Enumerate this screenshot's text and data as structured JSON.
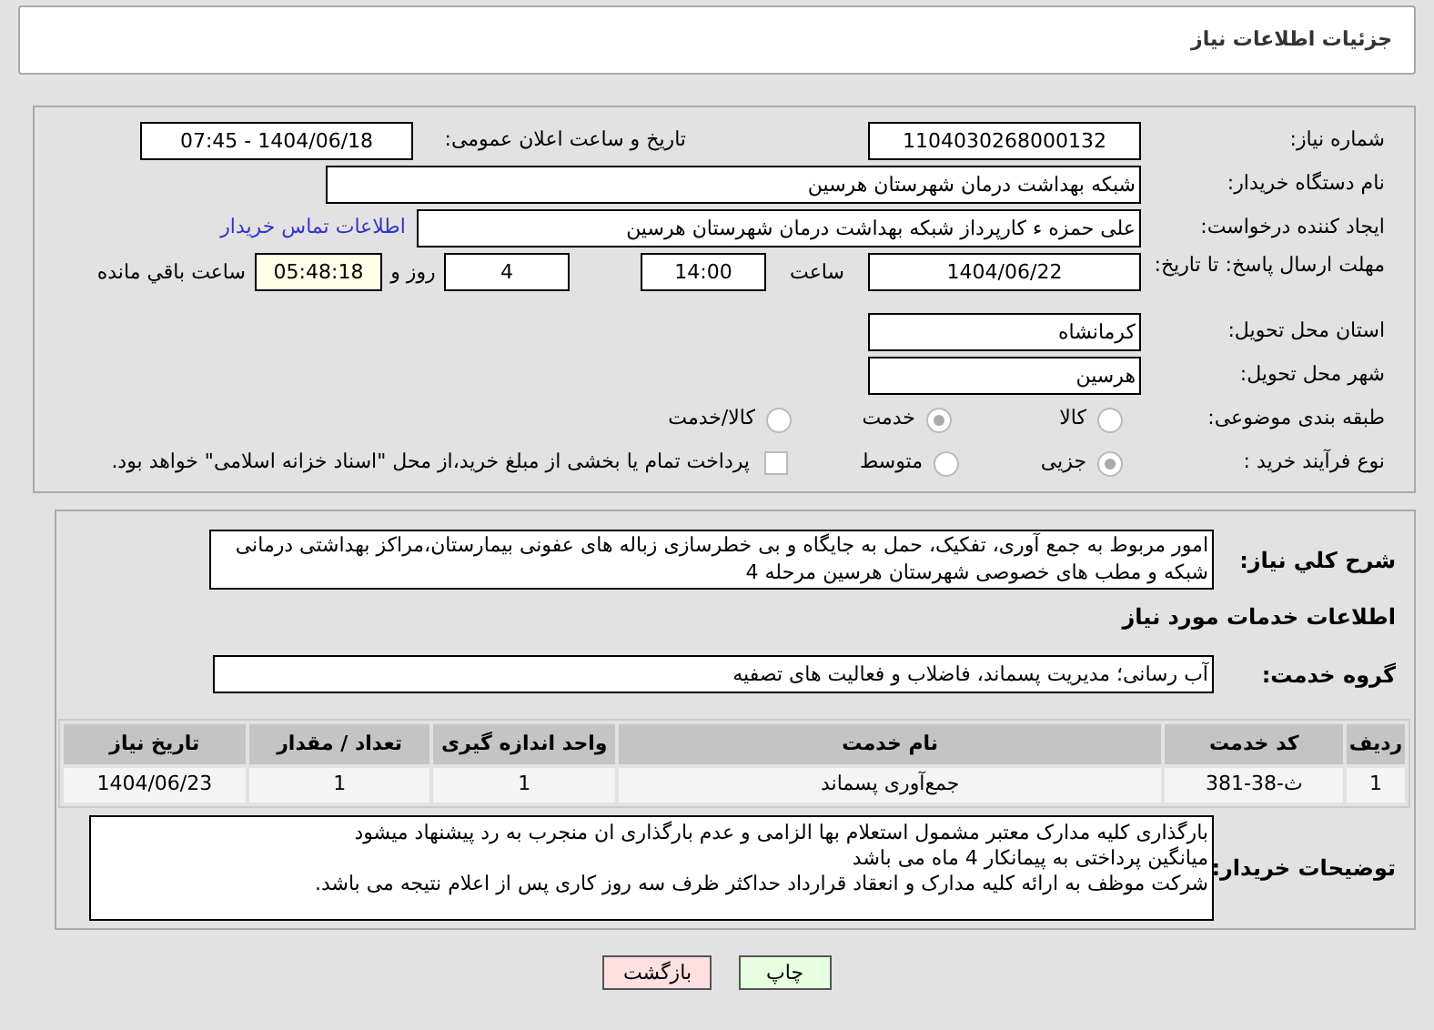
{
  "header": {
    "title": "جزئیات اطلاعات نیاز"
  },
  "need_number": {
    "label": "شماره نیاز:",
    "value": "1104030268000132"
  },
  "announce": {
    "label": "تاریخ و ساعت اعلان عمومی:",
    "value": "1404/06/18 - 07:45"
  },
  "buyer": {
    "label": "نام دستگاه خریدار:",
    "value": "شبکه بهداشت درمان شهرستان هرسین"
  },
  "creator": {
    "label": "ایجاد کننده درخواست:",
    "value": "علی حمزه ء کارپرداز شبکه بهداشت درمان شهرستان هرسین",
    "link": "اطلاعات تماس خریدار"
  },
  "deadline": {
    "label": "مهلت ارسال پاسخ: تا تاریخ:",
    "date": "1404/06/22",
    "time_label": "ساعت",
    "time": "14:00",
    "days": "4",
    "days_label": "روز و",
    "remaining": "05:48:18",
    "remaining_label": "ساعت باقي مانده"
  },
  "province": {
    "label": "استان محل تحویل:",
    "value": "کرمانشاه"
  },
  "city": {
    "label": "شهر محل تحویل:",
    "value": "هرسین"
  },
  "category": {
    "label": "طبقه بندی موضوعی:",
    "options": [
      {
        "label": "کالا",
        "selected": false
      },
      {
        "label": "خدمت",
        "selected": true
      },
      {
        "label": "کالا/خدمت",
        "selected": false
      }
    ]
  },
  "process": {
    "label": "نوع فرآیند خرید :",
    "options": [
      {
        "label": "جزیی",
        "selected": true
      },
      {
        "label": "متوسط",
        "selected": false
      }
    ],
    "treasury": {
      "checked": false,
      "label": "پرداخت تمام یا بخشی از مبلغ خرید،از محل \"اسناد خزانه اسلامی\" خواهد بود."
    }
  },
  "description": {
    "label": "شرح کلي نياز:",
    "value": "امور مربوط به جمع آوری، تفکیک، حمل به جایگاه و بی خطرسازی زباله های عفونی بیمارستان،مراکز بهداشتی درمانی شبکه و مطب های خصوصی شهرستان هرسین مرحله 4"
  },
  "services_title": "اطلاعات خدمات مورد نیاز",
  "service_group": {
    "label": "گروه خدمت:",
    "value": "آب رسانی؛ مدیریت پسماند، فاضلاب و فعالیت های تصفیه"
  },
  "table": {
    "columns": [
      "ردیف",
      "کد خدمت",
      "نام خدمت",
      "واحد اندازه گیری",
      "تعداد / مقدار",
      "تاریخ نیاز"
    ],
    "rows": [
      [
        "1",
        "ث-38-381",
        "جمع‌آوری پسماند",
        "1",
        "1",
        "1404/06/23"
      ]
    ]
  },
  "notes": {
    "label": "توضیحات خریدار:",
    "lines": [
      "بارگذاری کلیه مدارک معتبر مشمول استعلام بها الزامی و عدم بارگذاری ان منجرب به رد پیشنهاد میشود",
      "میانگین پرداختی به پیمانکار 4 ماه می باشد",
      "شرکت موظف به ارائه کلیه مدارک و انعقاد قرارداد حداکثر ظرف سه روز کاری پس از اعلام نتیجه می باشد."
    ]
  },
  "buttons": [
    {
      "label": "چاپ",
      "kind": "print"
    },
    {
      "label": "بازگشت",
      "kind": "back"
    }
  ]
}
